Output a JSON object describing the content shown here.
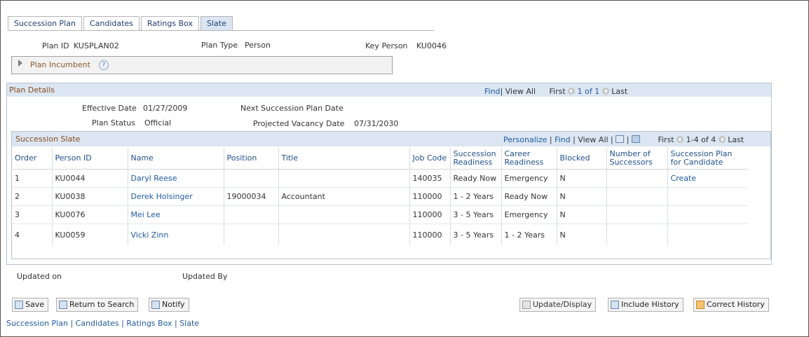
{
  "tabs": [
    {
      "label": "Succession Plan",
      "active": false
    },
    {
      "label": "Candidates",
      "active": false
    },
    {
      "label": "Ratings Box",
      "active": false
    },
    {
      "label": "Slate",
      "active": true
    }
  ],
  "header": {
    "plan_id_label": "Plan ID",
    "plan_id": "KUSPLAN02",
    "plan_type_label": "Plan Type",
    "plan_type": "Person",
    "key_person_label": "Key Person",
    "key_person": "KU0046"
  },
  "plan_incumbent": {
    "label": "Plan Incumbent",
    "help_icon": "?"
  },
  "plan_details": {
    "title": "Plan Details",
    "nav": {
      "find": "Find",
      "view_all": "View All",
      "first": "First",
      "counter": "1 of 1",
      "last": "Last"
    },
    "effective_date_label": "Effective Date",
    "effective_date": "01/27/2009",
    "next_plan_date_label": "Next Succession Plan Date",
    "next_plan_date": "",
    "plan_status_label": "Plan Status",
    "plan_status": "Official",
    "projected_vacancy_label": "Projected Vacancy Date",
    "projected_vacancy": "07/31/2030"
  },
  "slate": {
    "title": "Succession Slate",
    "nav": {
      "personalize": "Personalize",
      "find": "Find",
      "view_all": "View All",
      "first": "First",
      "counter": "1-4 of 4",
      "last": "Last"
    },
    "columns": [
      "Order",
      "Person ID",
      "Name",
      "Position",
      "Title",
      "Job Code",
      "Succession Readiness",
      "Career Readiness",
      "Blocked",
      "Number of Successors",
      "Succession Plan for Candidate"
    ],
    "rows": [
      {
        "order": "1",
        "person_id": "KU0044",
        "name": "Daryl Reese",
        "position": "",
        "title": "",
        "job_code": "140035",
        "succession_readiness": "Ready Now",
        "career_readiness": "Emergency",
        "blocked": "N",
        "successors": "",
        "plan_for_candidate": "Create"
      },
      {
        "order": "2",
        "person_id": "KU0038",
        "name": "Derek Holsinger",
        "position": "19000034",
        "title": "Accountant",
        "job_code": "110000",
        "succession_readiness": "1 - 2 Years",
        "career_readiness": "Ready Now",
        "blocked": "N",
        "successors": "",
        "plan_for_candidate": ""
      },
      {
        "order": "3",
        "person_id": "KU0076",
        "name": "Mei Lee",
        "position": "",
        "title": "",
        "job_code": "110000",
        "succession_readiness": "3 - 5 Years",
        "career_readiness": "Emergency",
        "blocked": "N",
        "successors": "",
        "plan_for_candidate": ""
      },
      {
        "order": "4",
        "person_id": "KU0059",
        "name": "Vicki Zinn",
        "position": "",
        "title": "",
        "job_code": "110000",
        "succession_readiness": "3 - 5 Years",
        "career_readiness": "1 - 2 Years",
        "blocked": "N",
        "successors": "",
        "plan_for_candidate": ""
      }
    ]
  },
  "footer": {
    "updated_on_label": "Updated on",
    "updated_by_label": "Updated By"
  },
  "toolbar": {
    "save": "Save",
    "return_to_search": "Return to Search",
    "notify": "Notify",
    "update_display": "Update/Display",
    "include_history": "Include History",
    "correct_history": "Correct History"
  },
  "bottom_links": [
    "Succession Plan",
    "Candidates",
    "Ratings Box",
    "Slate"
  ]
}
